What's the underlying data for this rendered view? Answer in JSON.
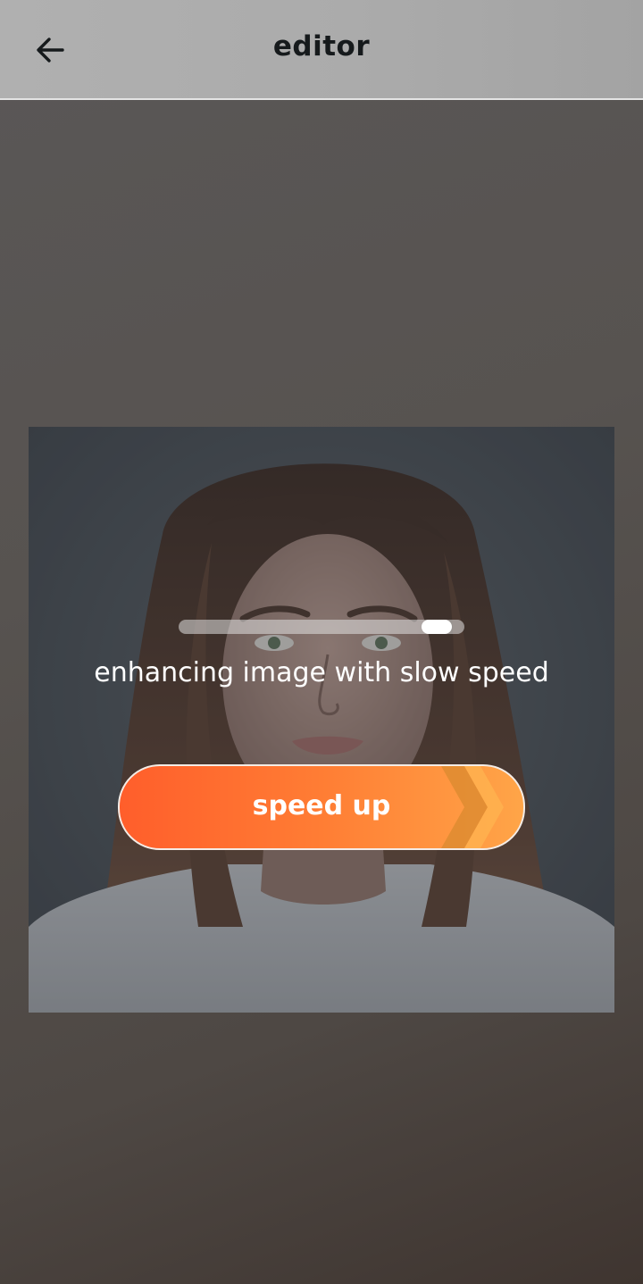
{
  "header": {
    "title": "editor",
    "back_icon": "arrow-left-icon"
  },
  "processing": {
    "progress": 0.95,
    "status_text": "enhancing image with slow speed"
  },
  "speed_button": {
    "label": "speed up",
    "icon": "double-chevron-right-icon",
    "gradient_start": "#ff5e2b",
    "gradient_end": "#ffa548"
  },
  "colors": {
    "header_bg": "#ababab",
    "title_text": "#161a1c"
  }
}
